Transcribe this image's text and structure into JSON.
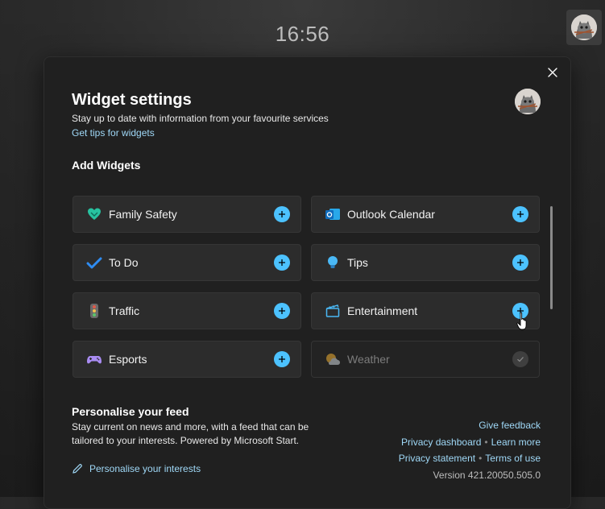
{
  "clock": "16:56",
  "panel": {
    "title": "Widget settings",
    "subtitle": "Stay up to date with information from your favourite services",
    "tips_link": "Get tips for widgets",
    "add_widgets_heading": "Add Widgets"
  },
  "widgets": [
    {
      "label": "Family Safety",
      "icon": "family-safety-icon",
      "state": "add"
    },
    {
      "label": "Outlook Calendar",
      "icon": "outlook-calendar-icon",
      "state": "add"
    },
    {
      "label": "To Do",
      "icon": "todo-icon",
      "state": "add"
    },
    {
      "label": "Tips",
      "icon": "tips-icon",
      "state": "add"
    },
    {
      "label": "Traffic",
      "icon": "traffic-icon",
      "state": "add"
    },
    {
      "label": "Entertainment",
      "icon": "entertainment-icon",
      "state": "add"
    },
    {
      "label": "Esports",
      "icon": "esports-icon",
      "state": "add"
    },
    {
      "label": "Weather",
      "icon": "weather-icon",
      "state": "added"
    }
  ],
  "feed": {
    "heading": "Personalise your feed",
    "description": "Stay current on news and more, with a feed that can be tailored to your interests. Powered by Microsoft Start.",
    "personalise_link": "Personalise your interests"
  },
  "links": {
    "give_feedback": "Give feedback",
    "privacy_dashboard": "Privacy dashboard",
    "learn_more": "Learn more",
    "privacy_statement": "Privacy statement",
    "terms_of_use": "Terms of use",
    "version": "Version 421.20050.505.0",
    "separator": "•"
  },
  "colors": {
    "accent": "#4cc2ff",
    "link": "#9fd8f7",
    "panel_bg": "#202020",
    "tile_bg": "#2c2c2c"
  }
}
